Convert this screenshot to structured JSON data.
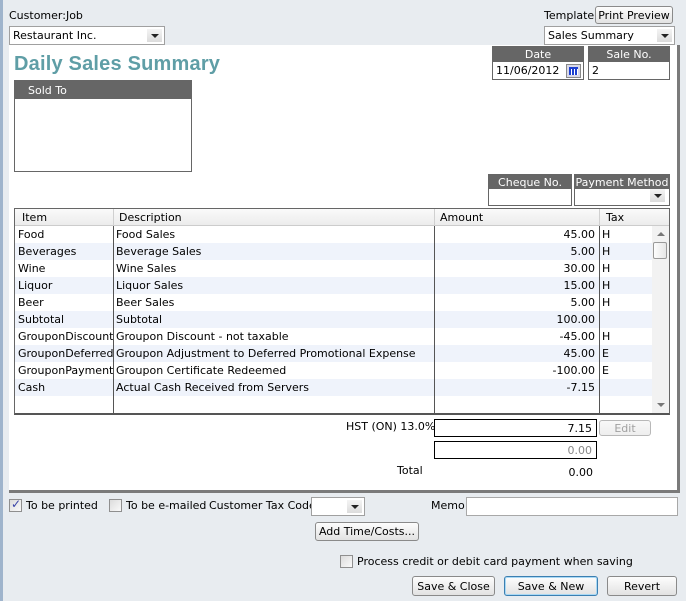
{
  "header": {
    "customer_job_label": "Customer:Job",
    "customer_job_value": "Restaurant Inc.",
    "template_label": "Template",
    "print_preview_label": "Print Preview",
    "template_value": "Sales Summary"
  },
  "form": {
    "title": "Daily Sales Summary",
    "title_color": "#5f9ea6",
    "sold_to_label": "Sold To",
    "sold_to_value": "",
    "date_label": "Date",
    "date_value": "11/06/2012",
    "sale_no_label": "Sale No.",
    "sale_no_value": "2",
    "cheque_no_label": "Cheque No.",
    "cheque_no_value": "",
    "payment_method_label": "Payment Method",
    "payment_method_value": ""
  },
  "grid": {
    "columns": [
      "Item",
      "Description",
      "Amount",
      "Tax"
    ],
    "rows": [
      {
        "item": "Food",
        "description": "Food Sales",
        "amount": "45.00",
        "tax": "H"
      },
      {
        "item": "Beverages",
        "description": "Beverage Sales",
        "amount": "5.00",
        "tax": "H"
      },
      {
        "item": "Wine",
        "description": "Wine Sales",
        "amount": "30.00",
        "tax": "H"
      },
      {
        "item": "Liquor",
        "description": "Liquor Sales",
        "amount": "15.00",
        "tax": "H"
      },
      {
        "item": "Beer",
        "description": "Beer Sales",
        "amount": "5.00",
        "tax": "H"
      },
      {
        "item": "Subtotal",
        "description": "Subtotal",
        "amount": "100.00",
        "tax": ""
      },
      {
        "item": "GrouponDiscount",
        "description": "Groupon Discount - not taxable",
        "amount": "-45.00",
        "tax": "H"
      },
      {
        "item": "GrouponDeferred",
        "description": "Groupon Adjustment to Deferred Promotional Expense",
        "amount": "45.00",
        "tax": "E"
      },
      {
        "item": "GrouponPayment",
        "description": "Groupon Certificate Redeemed",
        "amount": "-100.00",
        "tax": "E"
      },
      {
        "item": "Cash",
        "description": "Actual Cash Received from Servers",
        "amount": "-7.15",
        "tax": ""
      },
      {
        "item": "",
        "description": "",
        "amount": "",
        "tax": ""
      }
    ]
  },
  "totals": {
    "tax_label": "HST (ON) 13.0%",
    "tax_value": "7.15",
    "edit_label": "Edit",
    "second_value": "0.00",
    "total_label": "Total",
    "total_value": "0.00"
  },
  "footer": {
    "to_be_printed_label": "To be printed",
    "to_be_printed_checked": true,
    "to_be_emailed_label": "To be e-mailed",
    "to_be_emailed_checked": false,
    "customer_tax_code_label": "Customer Tax Code",
    "customer_tax_code_value": "",
    "memo_label": "Memo",
    "memo_value": "",
    "add_time_costs_label": "Add Time/Costs...",
    "process_card_label": "Process credit or debit card payment when saving",
    "process_card_checked": false,
    "save_close_label": "Save & Close",
    "save_new_label": "Save & New",
    "revert_label": "Revert"
  }
}
